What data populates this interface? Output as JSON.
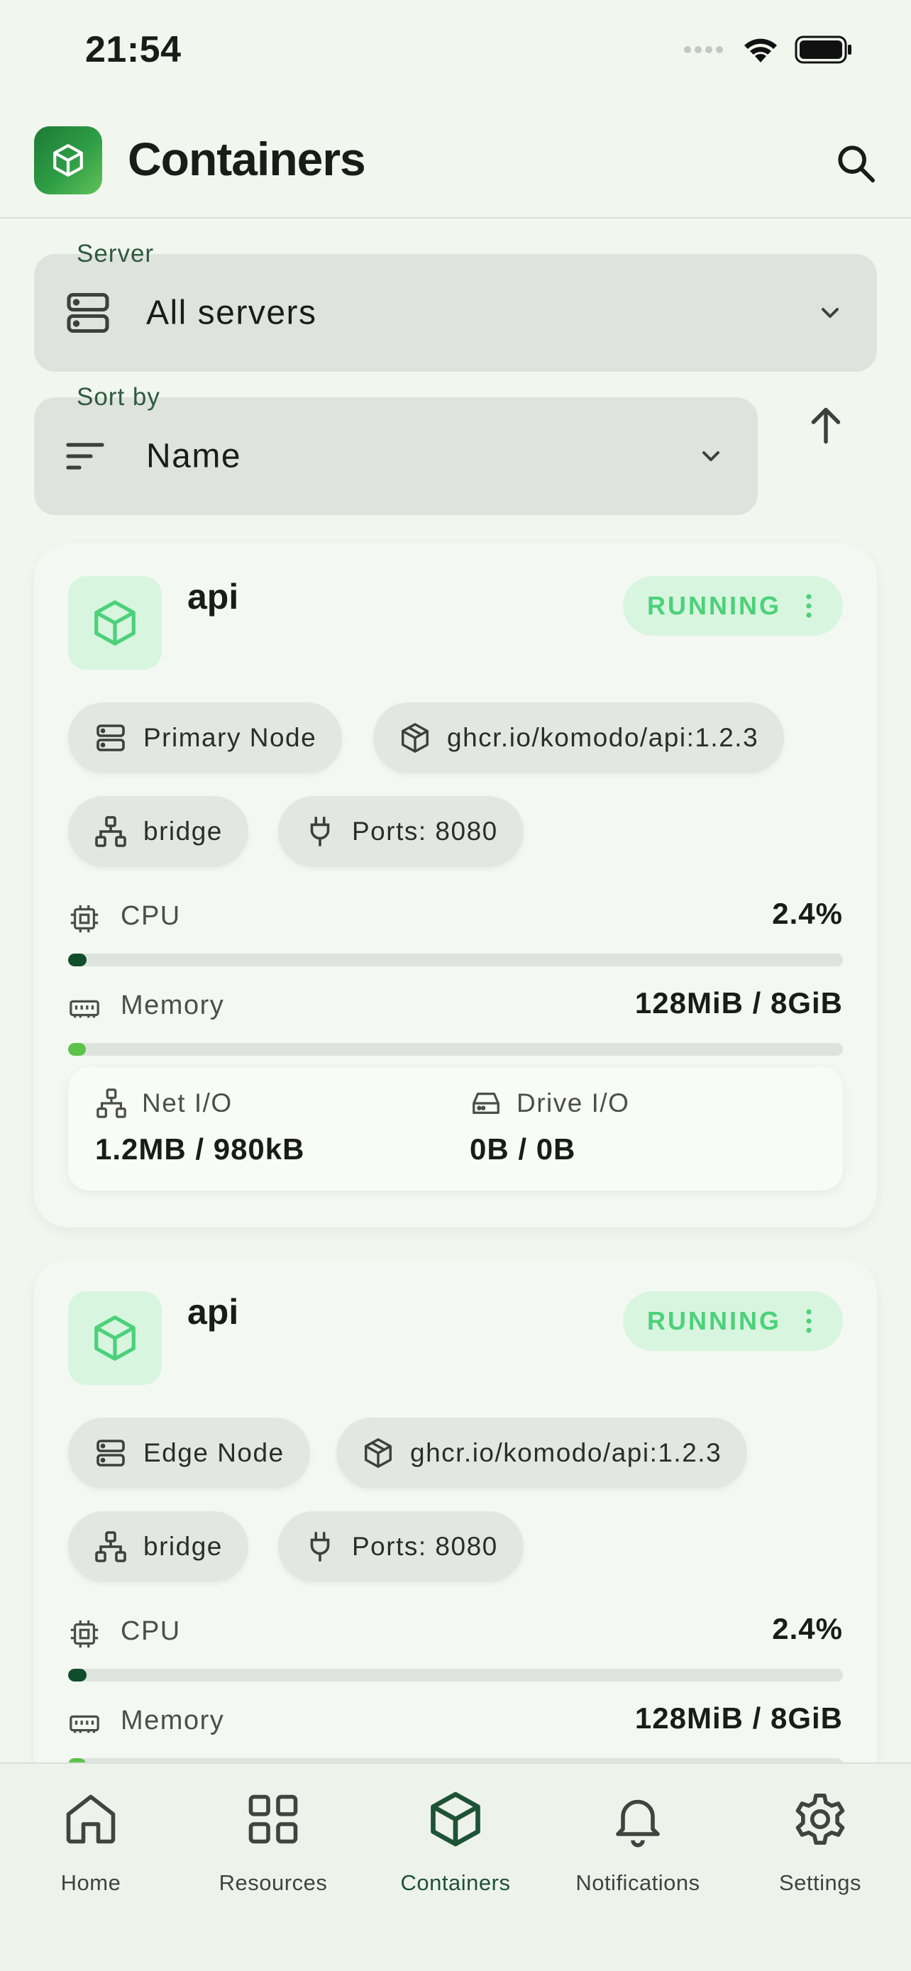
{
  "status_bar": {
    "time": "21:54"
  },
  "app_bar": {
    "title": "Containers"
  },
  "filters": {
    "server": {
      "label": "Server",
      "value": "All servers"
    },
    "sort": {
      "label": "Sort by",
      "value": "Name"
    }
  },
  "containers": [
    {
      "name": "api",
      "status": "RUNNING",
      "server": "Primary Node",
      "image": "ghcr.io/komodo/api:1.2.3",
      "network": "bridge",
      "ports": "Ports: 8080",
      "cpu_label": "CPU",
      "cpu_value": "2.4%",
      "cpu_fraction": 0.024,
      "memory_label": "Memory",
      "memory_value": "128MiB / 8GiB",
      "memory_fraction": 0.016,
      "net_label": "Net I/O",
      "net_value": "1.2MB / 980kB",
      "drive_label": "Drive I/O",
      "drive_value": "0B / 0B"
    },
    {
      "name": "api",
      "status": "RUNNING",
      "server": "Edge Node",
      "image": "ghcr.io/komodo/api:1.2.3",
      "network": "bridge",
      "ports": "Ports: 8080",
      "cpu_label": "CPU",
      "cpu_value": "2.4%",
      "cpu_fraction": 0.024,
      "memory_label": "Memory",
      "memory_value": "128MiB / 8GiB",
      "memory_fraction": 0.016
    }
  ],
  "nav": {
    "items": [
      {
        "label": "Home",
        "icon": "home-icon"
      },
      {
        "label": "Resources",
        "icon": "grid-icon"
      },
      {
        "label": "Containers",
        "icon": "cube-icon",
        "active": true
      },
      {
        "label": "Notifications",
        "icon": "bell-icon"
      },
      {
        "label": "Settings",
        "icon": "gear-icon"
      }
    ]
  },
  "colors": {
    "background": "#f1f6ef",
    "running": "#4cd17a",
    "running_bg": "#d8f5df",
    "cpu_bar": "#0f4d2b",
    "memory_bar": "#5cc24a",
    "active_nav": "#1e5236"
  }
}
